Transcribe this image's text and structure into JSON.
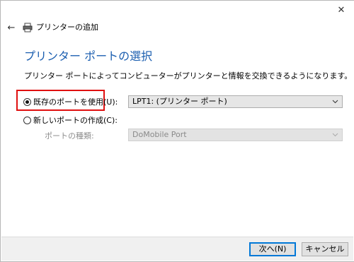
{
  "window": {
    "title": "プリンターの追加",
    "close_glyph": "✕",
    "back_glyph": "←",
    "icons": {
      "back": "back-arrow-icon",
      "printer": "printer-icon",
      "close": "close-icon",
      "dropdown": "chevron-down-icon"
    }
  },
  "page": {
    "heading": "プリンター ポートの選択",
    "description": "プリンター ポートによってコンピューターがプリンターと情報を交換できるようになります。"
  },
  "options": {
    "existing_port": {
      "label": "既存のポートを使用(U):",
      "checked": true
    },
    "existing_port_select": {
      "value": "LPT1: (プリンター ポート)"
    },
    "new_port": {
      "label": "新しいポートの作成(C):",
      "checked": false
    },
    "port_type": {
      "label": "ポートの種類:",
      "value": "DoMobile Port",
      "enabled": false
    }
  },
  "footer": {
    "next_label": "次へ(N)",
    "cancel_label": "キャンセル"
  },
  "colors": {
    "heading": "#1c5fb0",
    "highlight": "#e01010",
    "default_button_border": "#0078d7"
  }
}
